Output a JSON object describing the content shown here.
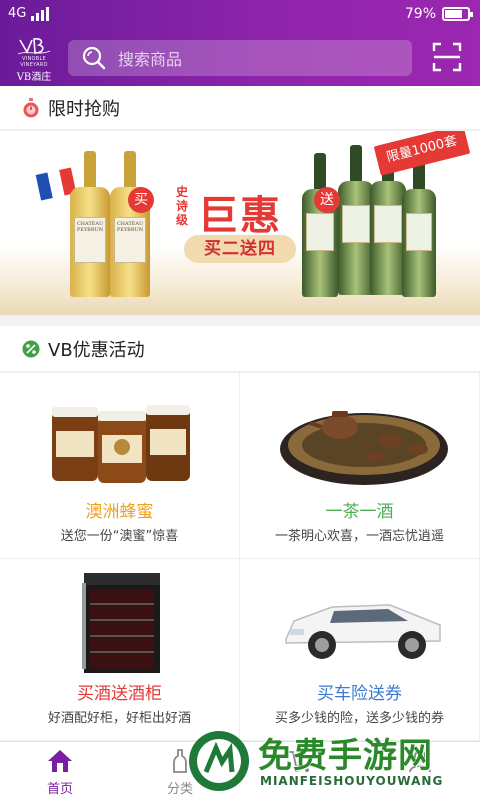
{
  "status_bar": {
    "network": "4G",
    "signal_bars": 4,
    "battery": "79%",
    "battery_level": 0.79
  },
  "header": {
    "logo_name": "VB酒庄",
    "logo_tiny": "VINOBLE VINEYARD",
    "search_placeholder": "搜索商品",
    "search_icon": "search-icon",
    "scan_icon": "scan-icon"
  },
  "flash_sale": {
    "title": "限时抢购",
    "icon": "stopwatch-icon",
    "banner": {
      "small_text": "史诗级",
      "big_text": "巨惠",
      "sub_text": "买二送四",
      "buy_tag": "买",
      "gift_tag": "送",
      "ribbon_text": "限量1000套",
      "bottle_label": "CHATEAU PEYBRUN"
    }
  },
  "promotions": {
    "title": "VB优惠活动",
    "icon": "discount-icon",
    "items": [
      {
        "name": "澳洲蜂蜜",
        "desc": "送您一份“澳蜜”惊喜",
        "color": "#f0a020",
        "image": "honey-jars"
      },
      {
        "name": "一茶一酒",
        "desc": "一茶明心欢喜，一酒忘忧逍遥",
        "color": "#4caf50",
        "image": "tea-set"
      },
      {
        "name": "买酒送酒柜",
        "desc": "好酒配好柜，好柜出好酒",
        "color": "#e53935",
        "image": "wine-cabinet"
      },
      {
        "name": "买车险送券",
        "desc": "买多少钱的险，送多少钱的券",
        "color": "#3a7bd5",
        "image": "white-suv"
      }
    ]
  },
  "tabbar": {
    "items": [
      {
        "label": "首页",
        "icon": "home-icon",
        "active": true
      },
      {
        "label": "分类",
        "icon": "category-icon",
        "active": false
      },
      {
        "label": "",
        "icon": "cart-icon",
        "active": false
      },
      {
        "label": "",
        "icon": "user-icon",
        "active": false
      }
    ]
  },
  "watermark": {
    "title": "免费手游网",
    "subtitle": "MIANFEISHOUYOUWANG"
  },
  "colors": {
    "brand_purple": "#8e24aa",
    "accent_red": "#e53935"
  }
}
